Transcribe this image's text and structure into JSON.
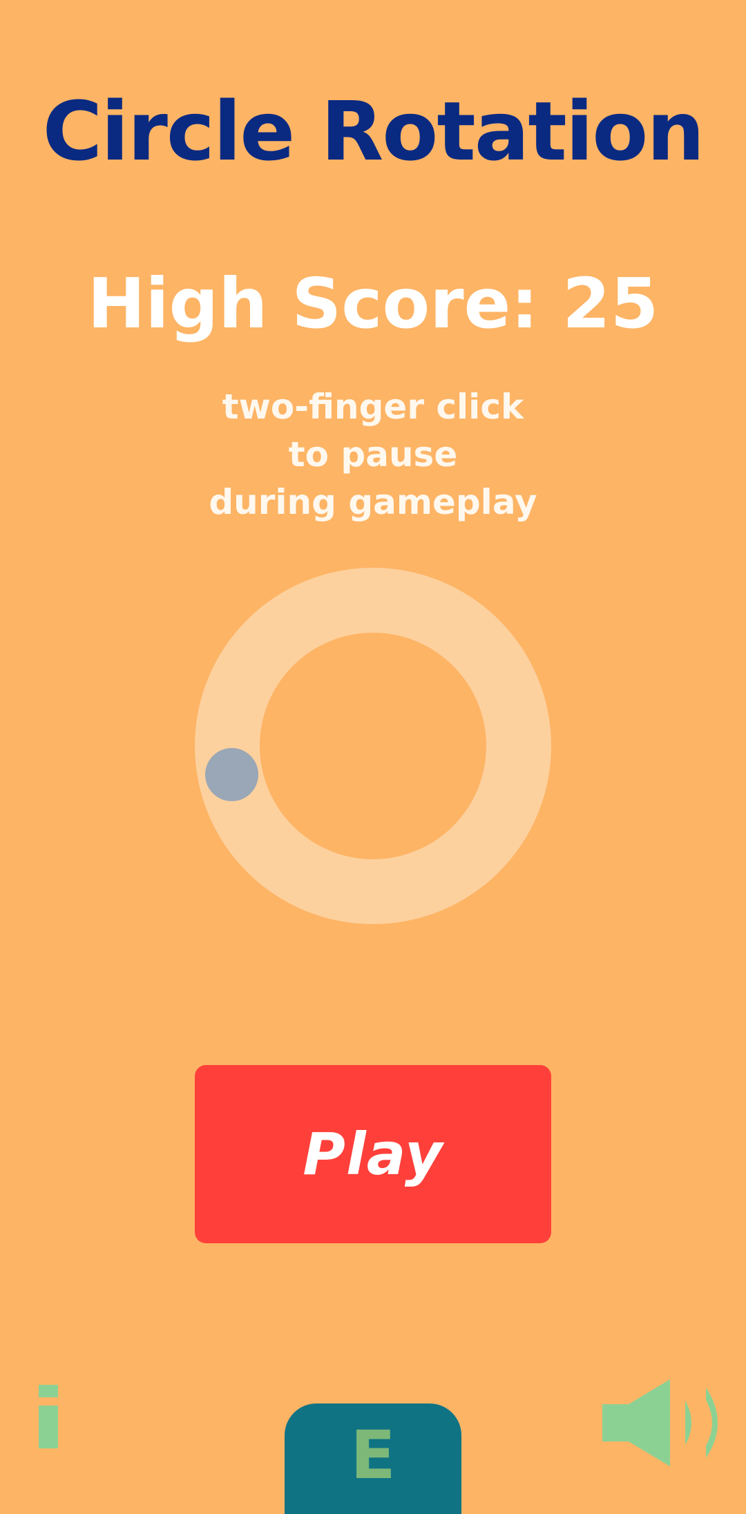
{
  "game": {
    "title": "Circle Rotation",
    "high_score_text": "High Score: 25",
    "instructions": [
      "two-finger click",
      "to pause",
      "during gameplay"
    ],
    "play_label": "Play",
    "e_label": "E"
  },
  "icons": {
    "info": "info-icon",
    "sound": "speaker-volume-icon"
  },
  "colors": {
    "background": "#FDB465",
    "title": "#0A2A82",
    "ring": "#FDD19E",
    "ball": "#99A7B6",
    "play_button": "#FF403A",
    "e_button": "#0F7383",
    "icon_green": "#8CD194"
  }
}
